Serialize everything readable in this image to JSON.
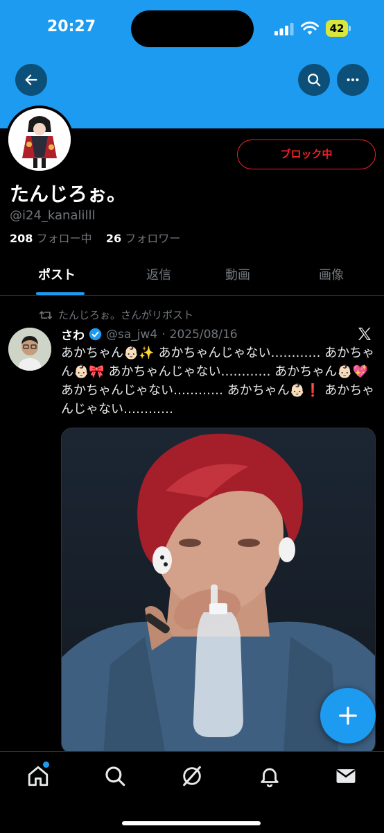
{
  "status_bar": {
    "time": "20:27",
    "battery": "42"
  },
  "profile": {
    "display_name": "たんじろぉ。",
    "handle": "@i24_kanalilll",
    "following_count": "208",
    "following_label": "フォロー中",
    "followers_count": "26",
    "followers_label": "フォロワー",
    "block_button_label": "ブロック中"
  },
  "tabs": [
    {
      "label": "ポスト",
      "active": true
    },
    {
      "label": "返信"
    },
    {
      "label": "動画"
    },
    {
      "label": "画像"
    }
  ],
  "post": {
    "repost_label": "たんじろぉ。さんがリポスト",
    "author_name": "さわ",
    "author_handle": "@sa_jw4",
    "date": "2025/08/16",
    "text": "あかちゃん👶🏻✨ あかちゃんじゃない………… あかちゃん👶🏻🎀 あかちゃんじゃない………… あかちゃん👶🏻💖 あかちゃんじゃない………… あかちゃん👶🏻❗ あかちゃんじゃない…………"
  },
  "colors": {
    "accent": "#1d9bf0",
    "block_red": "#f4212e",
    "muted": "#71767b"
  },
  "icons": {
    "header": [
      "back-arrow-icon",
      "search-icon",
      "more-icon"
    ],
    "nav": [
      "home-icon",
      "search-icon",
      "grok-icon",
      "notifications-bell-icon",
      "messages-envelope-icon"
    ]
  }
}
